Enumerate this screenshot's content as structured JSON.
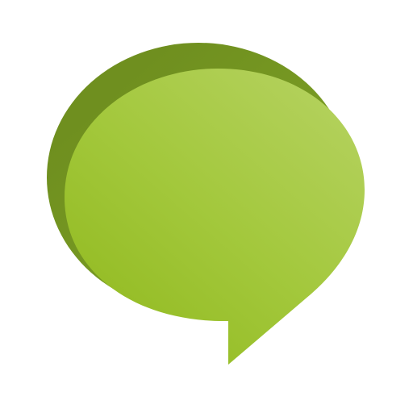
{
  "icon": {
    "name": "speech-bubble-icon",
    "colors": {
      "shadow_dark": "#6f8f1f",
      "shadow_mid": "#7fa326",
      "face_light": "#b2d05a",
      "face_mid": "#a3c83c",
      "face_dark": "#93bb22",
      "background": "#ffffff"
    }
  }
}
